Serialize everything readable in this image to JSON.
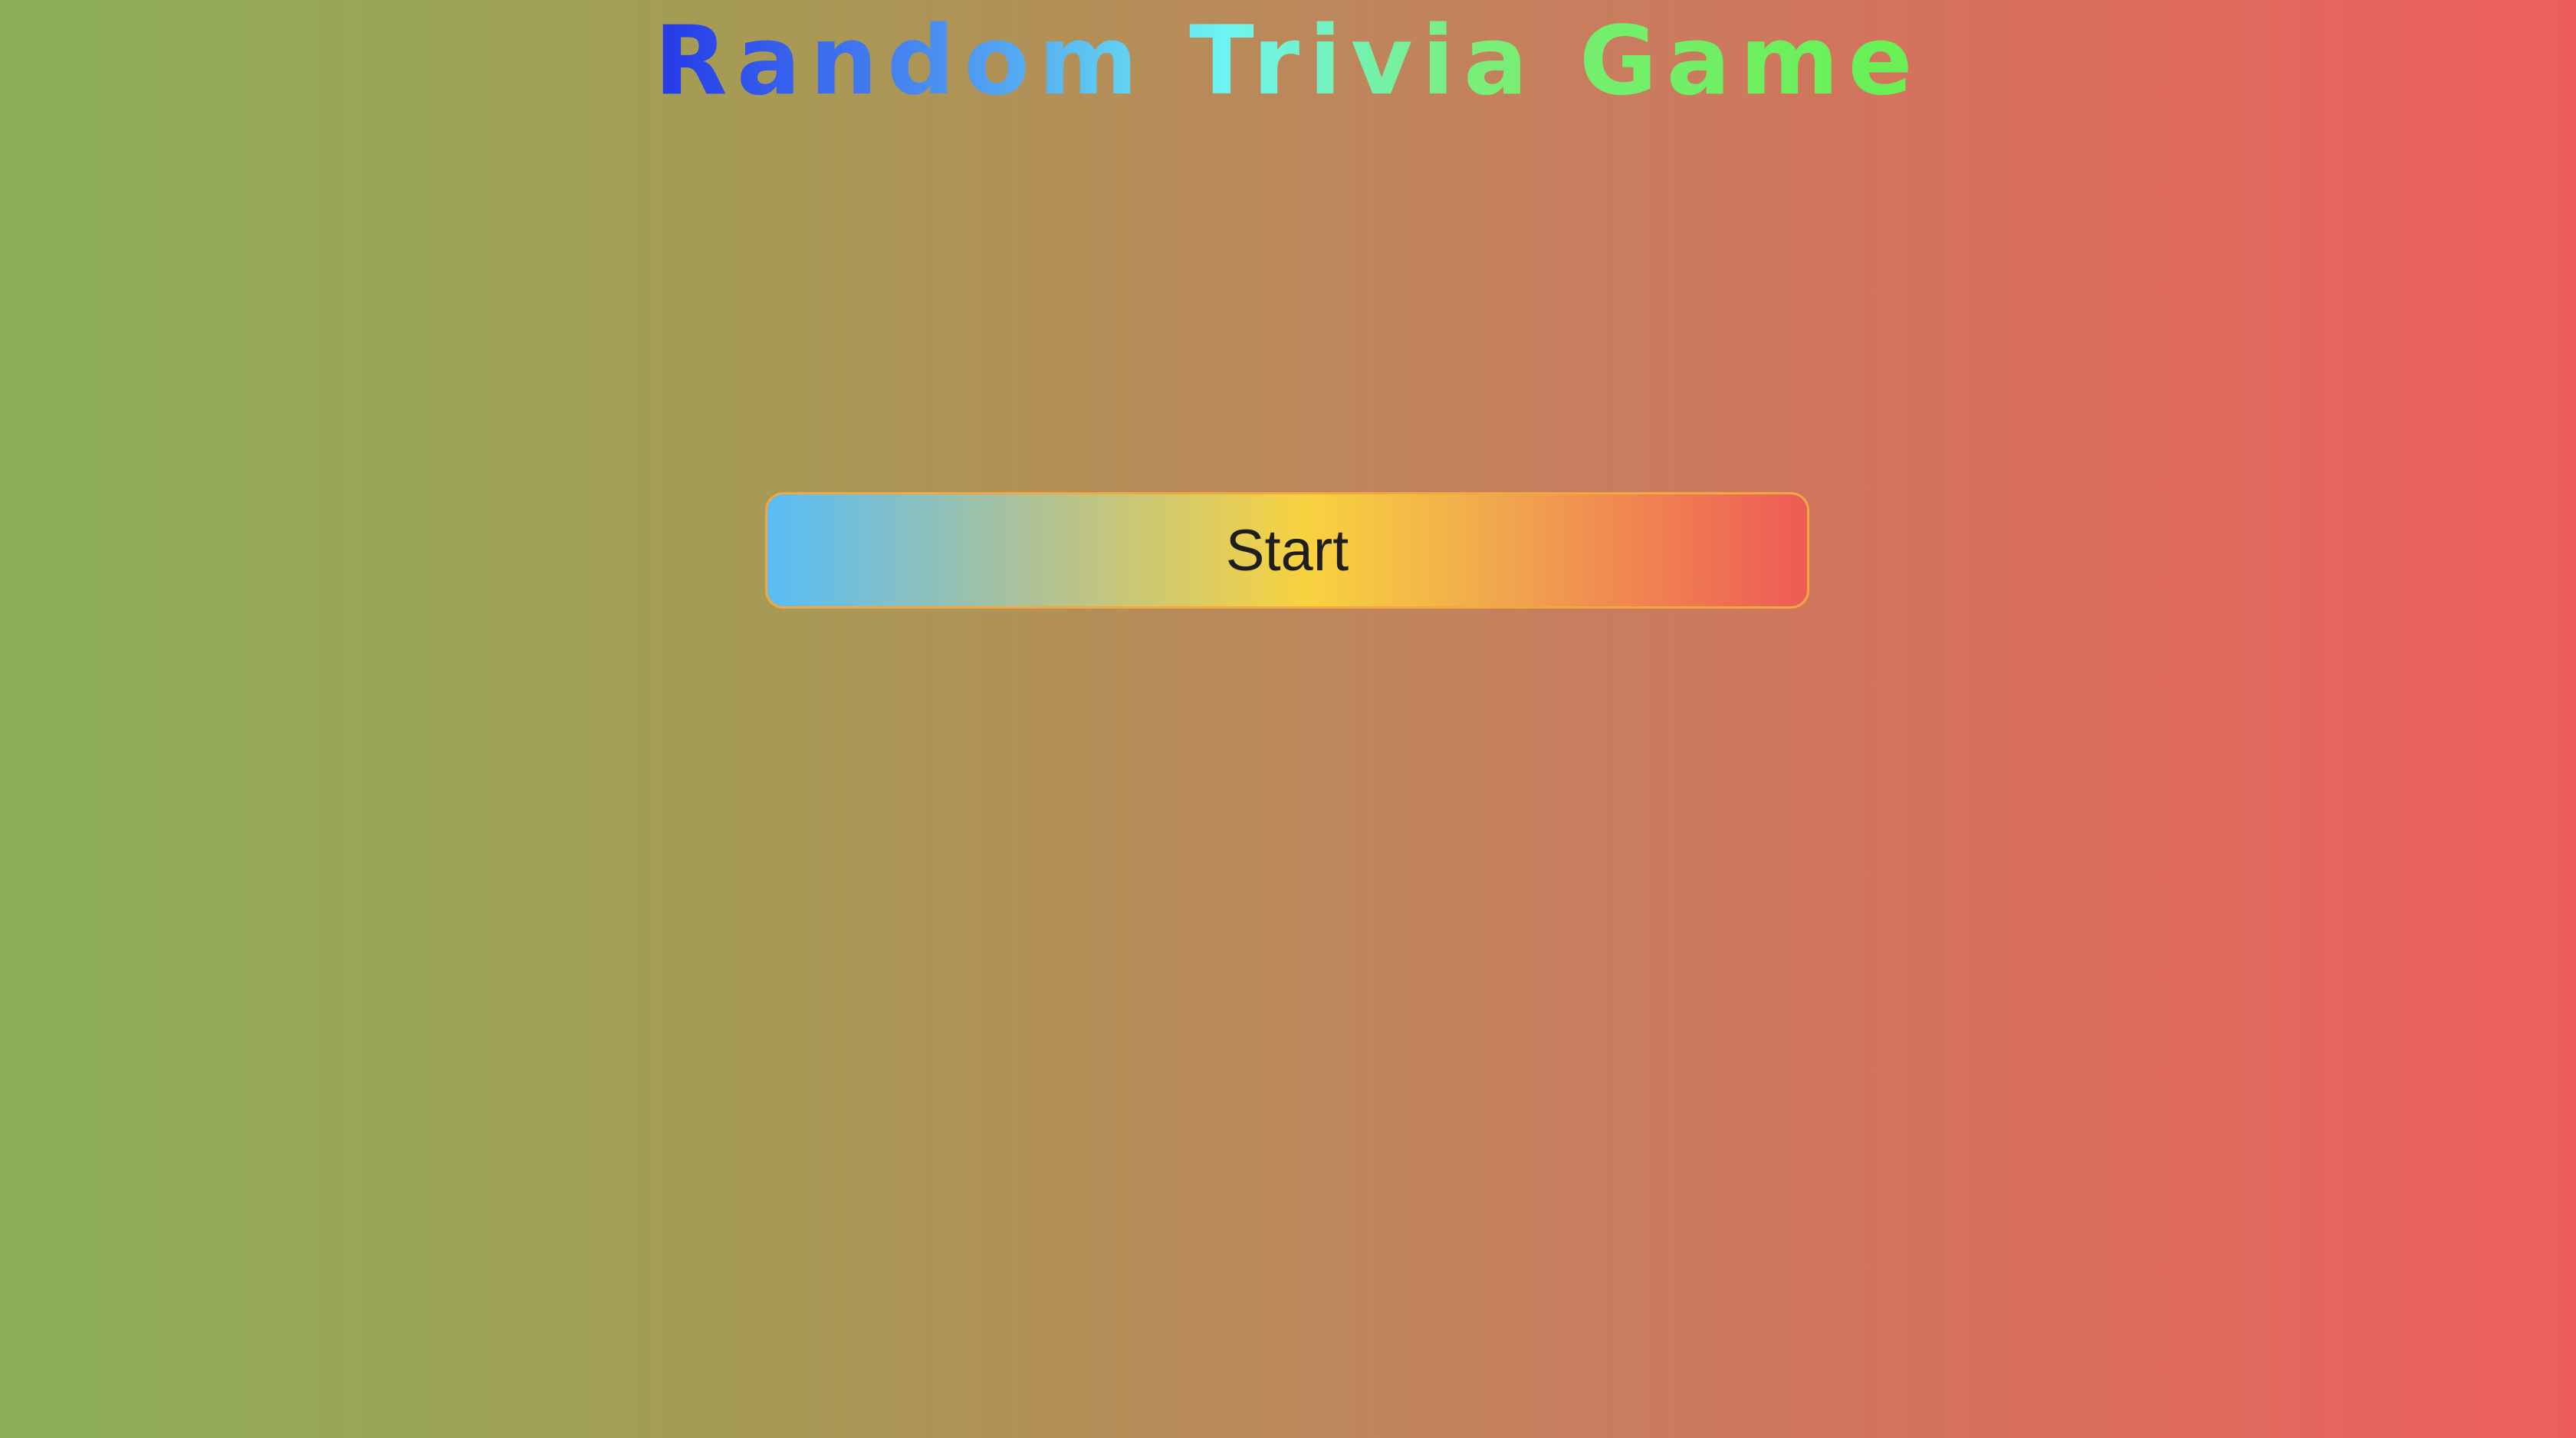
{
  "page": {
    "title": "Random Trivia Game"
  },
  "start_button": {
    "label": "Start"
  },
  "colors": {
    "background_left": "#8bb057",
    "background_right": "#ed5e5b",
    "title_gradient": [
      "#2438e8",
      "#6ef4f0",
      "#67f052"
    ],
    "button_gradient": [
      "#58bdf7",
      "#f8d23f",
      "#ef5b55"
    ],
    "button_border": "#f2a742"
  }
}
